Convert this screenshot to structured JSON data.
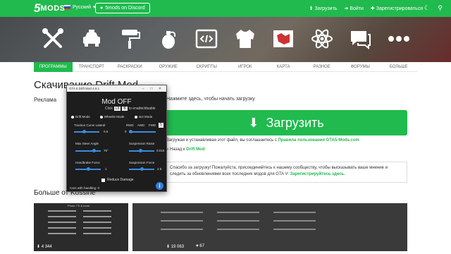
{
  "header": {
    "logo": {
      "five": "5",
      "mods": "MODS"
    },
    "language": "Русский",
    "discord_label": "5mods on Discord",
    "links": [
      {
        "icon": "upload-icon",
        "label": "Загрузить"
      },
      {
        "icon": "login-icon",
        "label": "Войти"
      },
      {
        "icon": "register-icon",
        "label": "Зарегистрироваться"
      }
    ]
  },
  "categories": [
    "tools-icon",
    "car-icon",
    "paint-roller-icon",
    "grenade-icon",
    "code-icon",
    "hoodie-icon",
    "map-icon",
    "atom-icon",
    "chat-icon",
    "more-icon"
  ],
  "nav": {
    "items": [
      "ПРОГРАММЫ",
      "ТРАНСПОРТ",
      "РАСКРАСКИ",
      "ОРУЖИЕ",
      "СКРИПТЫ",
      "ИГРОК",
      "КАРТА",
      "РАЗНОЕ",
      "ФОРУМЫ",
      "БОЛЬШЕ"
    ],
    "active_index": 0
  },
  "main": {
    "title": "Скачивание Drift Mod",
    "ad_label": "Реклама",
    "hint": "Нажмите здесь, чтобы начать загрузку",
    "download_label": "Загрузить",
    "agree_prefix": "Загружая и устанавливая этот файл, вы соглашаетесь с",
    "agree_link": "Правила пользования GTA5-Mods.com",
    "back_prefix": "« Назад к",
    "back_link": "Drift Mod",
    "thanks_text": "Спасибо за загрузку! Пожалуйста, присоединяйтесь к нашему сообществу, чтобы высказывать ваше мнение и следить за обновлениями всех последних модов для GTA V:",
    "thanks_link": "Зарегистрируйтесь здесь.",
    "more_label": "Больше от Kossine",
    "thumb_title": "Photo 7'S & more",
    "thumb_stats": {
      "downloads": "4 344",
      "likes": "67",
      "views": "19 063"
    }
  },
  "modwin": {
    "title": "GTA 5 Drift Mod 4.9.1",
    "mod_status": "Mod OFF",
    "click_label": "Click",
    "key1": "L5",
    "key2": "B",
    "click_suffix": "to enable/disable",
    "modes": [
      "Drift Mode",
      "Wheelie Mode",
      "4x4 Mode"
    ],
    "drive_labels": [
      "RWD",
      "AWD",
      "FWD"
    ],
    "drive_selected": "5",
    "traction_label": "Traction Curve Lateral",
    "traction_value": "0.5",
    "drive_value": "0",
    "steer_label": "Max Steer Angle",
    "steer_value": "75°",
    "suspension_raise_label": "Suspension Raise",
    "suspension_raise_value": "0.015",
    "handbrake_label": "Handbrake Force",
    "handbrake_value": "1",
    "suspension_force_label": "Suspension Force",
    "suspension_force_value": "2.5",
    "reduce_damage_label": "Reduce Damage",
    "footer_label": "Cars with handling: 0",
    "info_label": "i"
  }
}
